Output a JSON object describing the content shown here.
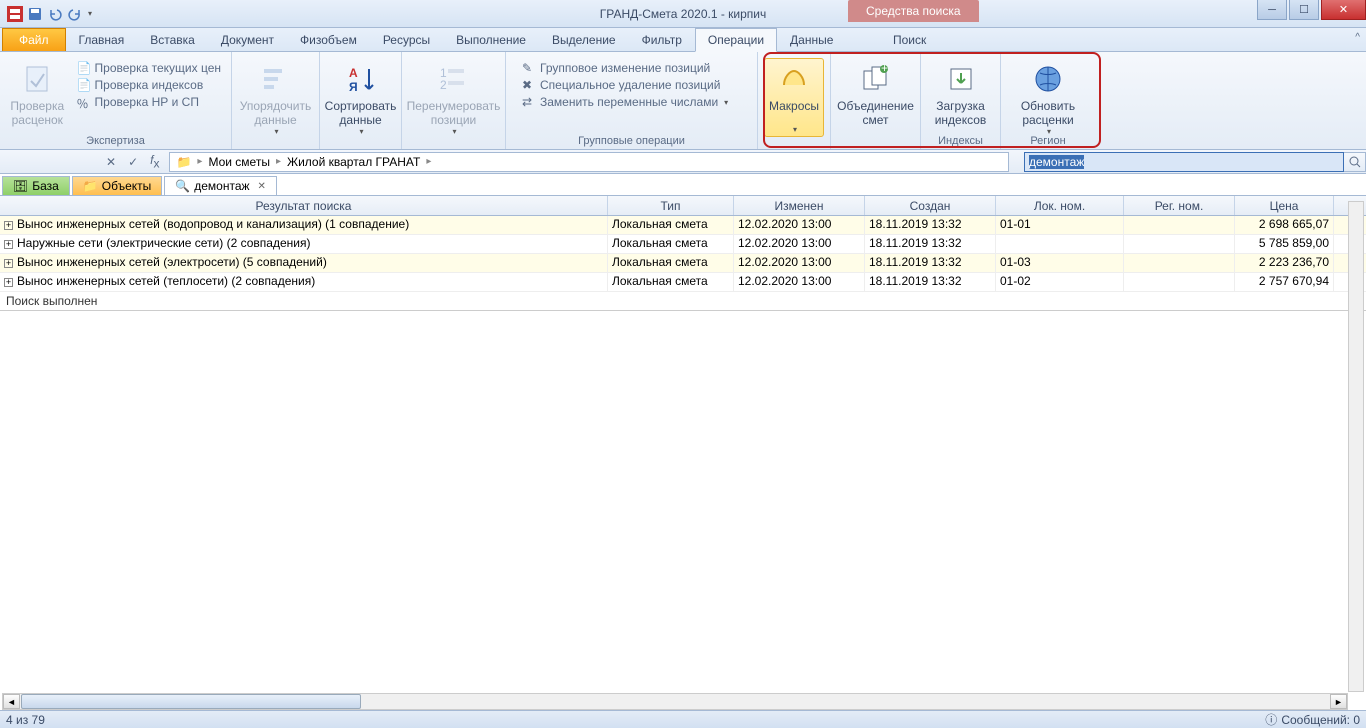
{
  "title": "ГРАНД-Смета 2020.1 -  кирпич",
  "contextTab": "Средства поиска",
  "tabs": {
    "file": "Файл",
    "items": [
      "Главная",
      "Вставка",
      "Документ",
      "Физобъем",
      "Ресурсы",
      "Выполнение",
      "Выделение",
      "Фильтр",
      "Операции",
      "Данные"
    ],
    "search": "Поиск",
    "activeIndex": 8
  },
  "ribbon": {
    "g1": {
      "label": "Экспертиза",
      "big": "Проверка расценок",
      "items": [
        "Проверка текущих цен",
        "Проверка индексов",
        "Проверка НР и СП"
      ]
    },
    "g2": {
      "big": "Упорядочить данные"
    },
    "g3": {
      "big": "Сортировать данные"
    },
    "g4": {
      "big": "Перенумеровать позиции"
    },
    "g5": {
      "label": "Групповые операции",
      "items": [
        "Групповое изменение позиций",
        "Специальное удаление позиций",
        "Заменить переменные числами"
      ]
    },
    "g6": {
      "big": "Макросы"
    },
    "g7": {
      "big": "Объединение смет"
    },
    "g8": {
      "big": "Загрузка индексов",
      "label": "Индексы"
    },
    "g9": {
      "big": "Обновить расценки",
      "label": "Регион"
    }
  },
  "breadcrumb": {
    "a": "Мои сметы",
    "b": "Жилой квартал ГРАНАТ"
  },
  "searchValue": "демонтаж",
  "viewTabs": {
    "base": "База",
    "objects": "Объекты",
    "search": "демонтаж"
  },
  "columns": {
    "result": "Результат поиска",
    "type": "Тип",
    "modified": "Изменен",
    "created": "Создан",
    "loc": "Лок. ном.",
    "reg": "Рег. ном.",
    "price": "Цена"
  },
  "rows": [
    {
      "result": "Вынос инженерных сетей (водопровод и канализация) (1 совпадение)",
      "type": "Локальная смета",
      "modified": "12.02.2020 13:00",
      "created": "18.11.2019 13:32",
      "loc": "01-01",
      "reg": "",
      "price": "2 698 665,07"
    },
    {
      "result": "Наружные сети (электрические сети) (2 совпадения)",
      "type": "Локальная смета",
      "modified": "12.02.2020 13:00",
      "created": "18.11.2019 13:32",
      "loc": "",
      "reg": "",
      "price": "5 785 859,00"
    },
    {
      "result": "Вынос инженерных сетей (электросети) (5 совпадений)",
      "type": "Локальная смета",
      "modified": "12.02.2020 13:00",
      "created": "18.11.2019 13:32",
      "loc": "01-03",
      "reg": "",
      "price": "2 223 236,70"
    },
    {
      "result": "Вынос инженерных сетей (теплосети) (2 совпадения)",
      "type": "Локальная смета",
      "modified": "12.02.2020 13:00",
      "created": "18.11.2019 13:32",
      "loc": "01-02",
      "reg": "",
      "price": "2 757 670,94"
    }
  ],
  "statusMsg": "Поиск выполнен",
  "statusbar": {
    "left": "4 из 79",
    "right": "Сообщений: 0"
  }
}
